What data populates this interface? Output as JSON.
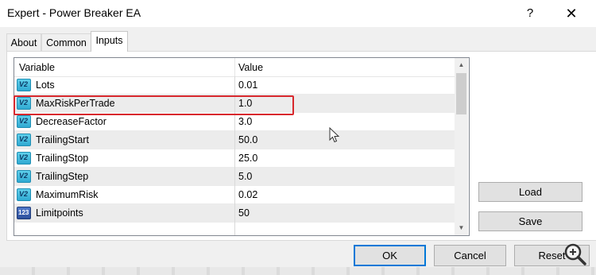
{
  "window": {
    "title": "Expert - Power Breaker EA",
    "help_glyph": "?",
    "close_glyph": "✕"
  },
  "tabs": [
    {
      "label": "About"
    },
    {
      "label": "Common"
    },
    {
      "label": "Inputs"
    }
  ],
  "grid": {
    "headers": {
      "variable": "Variable",
      "value": "Value"
    },
    "rows": [
      {
        "variable": "Lots",
        "value": "0.01",
        "icon": "double-type-icon"
      },
      {
        "variable": "MaxRiskPerTrade",
        "value": "1.0",
        "icon": "double-type-icon"
      },
      {
        "variable": "DecreaseFactor",
        "value": "3.0",
        "icon": "double-type-icon"
      },
      {
        "variable": "TrailingStart",
        "value": "50.0",
        "icon": "double-type-icon"
      },
      {
        "variable": "TrailingStop",
        "value": "25.0",
        "icon": "double-type-icon"
      },
      {
        "variable": "TrailingStep",
        "value": "5.0",
        "icon": "double-type-icon"
      },
      {
        "variable": "MaximumRisk",
        "value": "0.02",
        "icon": "double-type-icon"
      },
      {
        "variable": "Limitpoints",
        "value": "50",
        "icon": "integer-type-icon"
      }
    ],
    "icon_text": {
      "double": "V2",
      "integer": "123"
    }
  },
  "buttons": {
    "load": "Load",
    "save": "Save",
    "ok": "OK",
    "cancel": "Cancel",
    "reset": "Reset"
  },
  "colors": {
    "highlight": "#d8282d",
    "default_button_border": "#0078d7",
    "icon_double": "#2fa9d1",
    "icon_integer": "#2c4f9c"
  }
}
